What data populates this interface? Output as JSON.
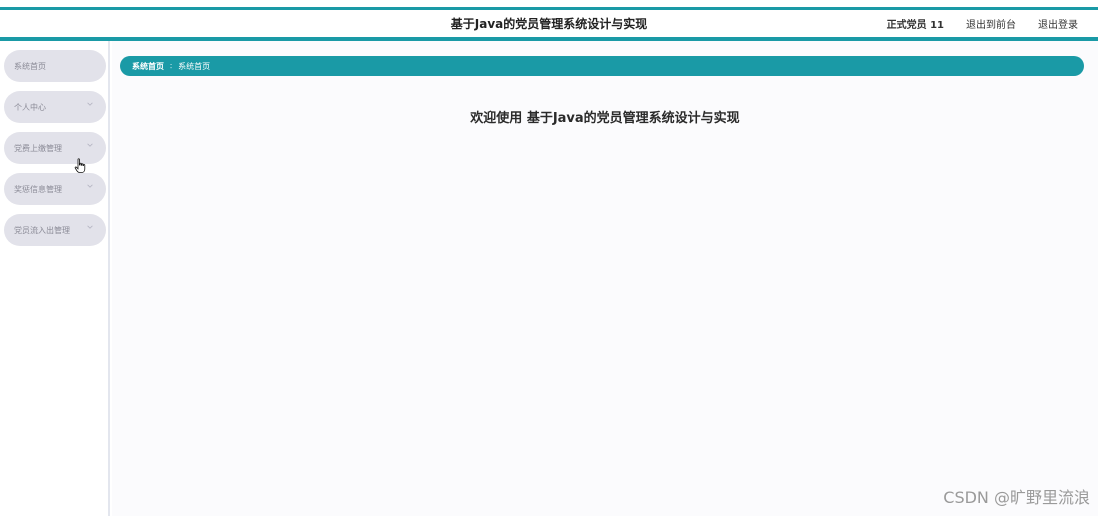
{
  "header": {
    "title": "基于Java的党员管理系统设计与实现",
    "user": "正式党员 11",
    "exit_front": "退出到前台",
    "logout": "退出登录"
  },
  "sidebar": {
    "items": [
      {
        "label": "系统首页",
        "has_chevron": false
      },
      {
        "label": "个人中心",
        "has_chevron": true
      },
      {
        "label": "党费上缴管理",
        "has_chevron": true
      },
      {
        "label": "奖惩信息管理",
        "has_chevron": true
      },
      {
        "label": "党员流入出管理",
        "has_chevron": true
      }
    ]
  },
  "breadcrumb": {
    "items": [
      "系统首页",
      "系统首页"
    ],
    "separator": "∶"
  },
  "main": {
    "welcome": "欢迎使用 基于Java的党员管理系统设计与实现"
  },
  "watermark": "CSDN @旷野里流浪",
  "colors": {
    "accent": "#1a9aa6",
    "menu_bg": "#e2e2ea"
  }
}
